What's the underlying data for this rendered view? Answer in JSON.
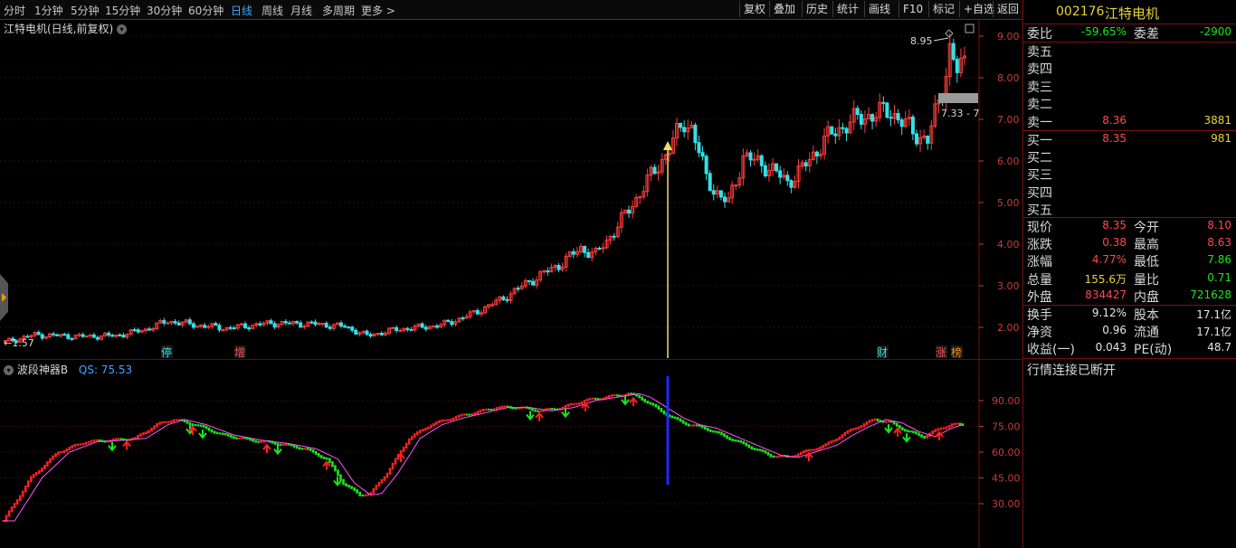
{
  "toolbar": {
    "periods": [
      "分时",
      "1分钟",
      "5分钟",
      "15分钟",
      "30分钟",
      "60分钟",
      "日线",
      "周线",
      "月线",
      "多周期",
      "更多 >"
    ],
    "active_period": "日线",
    "buttons": [
      "复权",
      "叠加",
      "历史",
      "统计",
      "画线",
      "F10",
      "标记",
      "+自选",
      "返回"
    ]
  },
  "main_chart": {
    "title": "江特电机(日线,前复权)",
    "y_ticks": [
      "9.00",
      "8.00",
      "7.00",
      "6.00",
      "5.00",
      "4.00",
      "3.00",
      "2.00"
    ],
    "high_label": "8.95",
    "low_label": "1.57",
    "range_label": "7.33 - 7",
    "markers": [
      "停",
      "增",
      "财",
      "涨",
      "榜"
    ]
  },
  "indicator": {
    "name": "波段神器B",
    "qs_label": "QS: 75.53",
    "y_ticks": [
      "90.00",
      "75.00",
      "60.00",
      "45.00",
      "30.00"
    ]
  },
  "quote": {
    "code": "002176",
    "name": "江特电机",
    "weibi_label": "委比",
    "weibi": "-59.65%",
    "weicha_label": "委差",
    "weicha": "-2900",
    "sell": [
      {
        "label": "卖五",
        "price": "",
        "vol": ""
      },
      {
        "label": "卖四",
        "price": "",
        "vol": ""
      },
      {
        "label": "卖三",
        "price": "",
        "vol": ""
      },
      {
        "label": "卖二",
        "price": "",
        "vol": ""
      },
      {
        "label": "卖一",
        "price": "8.36",
        "vol": "3881"
      }
    ],
    "buy": [
      {
        "label": "买一",
        "price": "8.35",
        "vol": "981"
      },
      {
        "label": "买二",
        "price": "",
        "vol": ""
      },
      {
        "label": "买三",
        "price": "",
        "vol": ""
      },
      {
        "label": "买四",
        "price": "",
        "vol": ""
      },
      {
        "label": "买五",
        "price": "",
        "vol": ""
      }
    ],
    "stats1": [
      {
        "l1": "现价",
        "v1": "8.35",
        "c1": "red",
        "l2": "今开",
        "v2": "8.10",
        "c2": "red"
      },
      {
        "l1": "涨跌",
        "v1": "0.38",
        "c1": "red",
        "l2": "最高",
        "v2": "8.63",
        "c2": "red"
      },
      {
        "l1": "涨幅",
        "v1": "4.77%",
        "c1": "red",
        "l2": "最低",
        "v2": "7.86",
        "c2": "green"
      },
      {
        "l1": "总量",
        "v1": "155.6万",
        "c1": "yellow",
        "l2": "量比",
        "v2": "0.71",
        "c2": "green"
      },
      {
        "l1": "外盘",
        "v1": "834427",
        "c1": "red",
        "l2": "内盘",
        "v2": "721628",
        "c2": "green"
      }
    ],
    "stats2": [
      {
        "l1": "换手",
        "v1": "9.12%",
        "c1": "white",
        "l2": "股本",
        "v2": "17.1亿",
        "c2": "white"
      },
      {
        "l1": "净资",
        "v1": "0.96",
        "c1": "white",
        "l2": "流通",
        "v2": "17.1亿",
        "c2": "white"
      },
      {
        "l1": "收益(一)",
        "v1": "0.043",
        "c1": "white",
        "l2": "PE(动)",
        "v2": "48.7",
        "c2": "white"
      }
    ],
    "status": "行情连接已断开"
  }
}
